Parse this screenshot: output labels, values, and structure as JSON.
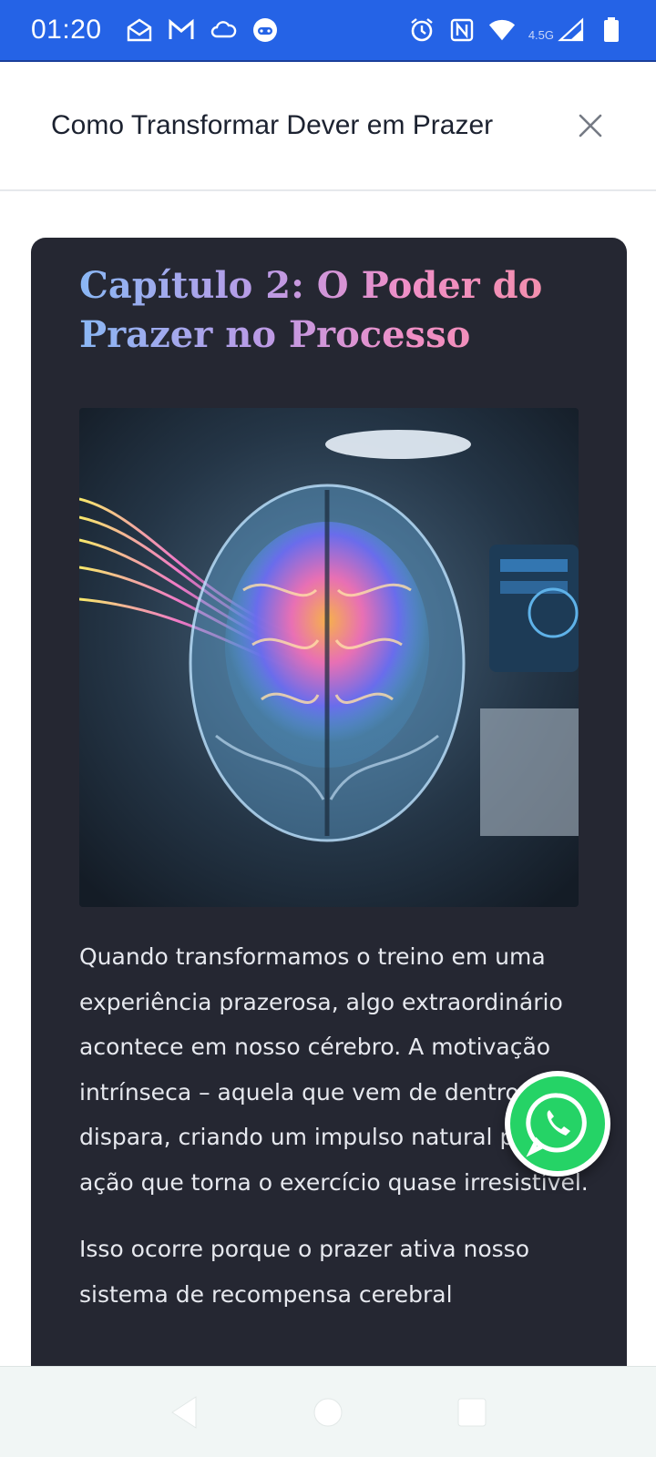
{
  "status_bar": {
    "time": "01:20",
    "network_label": "4.5G",
    "left_icons": [
      "mail-open-icon",
      "gmail-icon",
      "cloud-icon",
      "game-icon"
    ],
    "right_icons": [
      "alarm-icon",
      "nfc-icon",
      "wifi-icon",
      "signal-icon",
      "battery-icon"
    ]
  },
  "header": {
    "title": "Como Transformar Dever em Prazer",
    "close_icon": "close-icon"
  },
  "card": {
    "chapter_title": "Capítulo 2: O Poder do Prazer no Processo",
    "image_alt": "brain-illustration",
    "paragraphs": [
      "Quando transformamos o treino em uma experiência prazerosa, algo extraordinário acontece em nosso cérebro. A motivação intrínseca – aquela que vem de dentro – dispara, criando um impulso natural para a ação que torna o exercício quase irresistível.",
      "Isso ocorre porque o prazer ativa nosso sistema de recompensa cerebral"
    ]
  },
  "floating_button": {
    "icon": "whatsapp-icon"
  },
  "nav_bar": {
    "buttons": [
      "back-icon",
      "home-icon",
      "recents-icon"
    ]
  },
  "colors": {
    "status_bar": "#2563e6",
    "card_bg": "#252732",
    "body_text": "#e6e8ee",
    "whatsapp_green": "#25d366"
  }
}
